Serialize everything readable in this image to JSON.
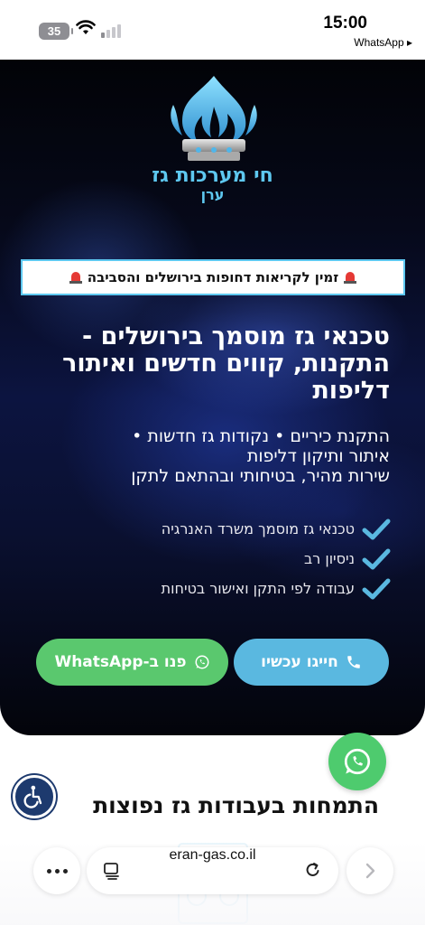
{
  "status_bar": {
    "battery": "35",
    "time": "15:00",
    "back_app": "WhatsApp ▸"
  },
  "hero": {
    "brand_name": "חי מערכות גז",
    "brand_sub": "ערן",
    "alert_text": "זמין לקריאות דחופות בירושלים והסביבה",
    "title": "טכנאי גז מוסמך בירושלים - התקנות, קווים חדשים ואיתור דליפות",
    "subtitle_line1": "התקנת כיריים • נקודות גז חדשות •",
    "subtitle_line2": "איתור ותיקון דליפות",
    "subtitle_line3": "שירות מהיר, בטיחותי ובהתאם לתקן",
    "features": [
      "טכנאי גז מוסמך משרד האנרגיה",
      "ניסיון רב",
      "עבודה לפי התקן ואישור בטיחות"
    ],
    "call_button": "חייגו עכשיו",
    "whatsapp_button": "פנו ב-WhatsApp"
  },
  "section": {
    "title": "התמחות בעבודות גז נפוצות"
  },
  "browser": {
    "url": "eran-gas.co.il"
  },
  "colors": {
    "accent_blue": "#5ec8f0",
    "call_button": "#5ab8e0",
    "whatsapp_green": "#5ac86e",
    "a11y_navy": "#1d3a6e"
  },
  "icons": {
    "logo": "gas-burner-flame-logo",
    "alert": "siren-icon",
    "feature": "checkmark-icon",
    "call": "phone-icon",
    "whatsapp": "whatsapp-icon",
    "accessibility": "wheelchair-icon",
    "more": "more-dots-icon",
    "tabs": "tabs-icon",
    "reload": "reload-icon",
    "forward": "chevron-right-icon"
  }
}
